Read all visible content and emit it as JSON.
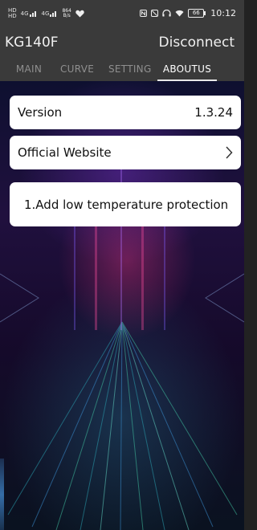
{
  "status_bar": {
    "left_tiny_1": "HD",
    "left_tiny_2": "HD",
    "net_1": "4G",
    "net_2": "4G",
    "speed_value": "864",
    "speed_unit": "B/s",
    "battery": "66",
    "time": "10:12"
  },
  "header": {
    "title": "KG140F",
    "disconnect": "Disconnect"
  },
  "tabs": [
    {
      "label": "MAIN"
    },
    {
      "label": "CURVE"
    },
    {
      "label": "SETTING"
    },
    {
      "label": "ABOUTUS",
      "active": true
    }
  ],
  "about": {
    "version_label": "Version",
    "version_value": "1.3.24",
    "website_label": "Official Website",
    "release_note": "1.Add low temperature protection"
  },
  "colors": {
    "bar_bg": "#3a3a3a",
    "tab_inactive": "#8f8f8f",
    "card_bg": "#ffffff"
  }
}
